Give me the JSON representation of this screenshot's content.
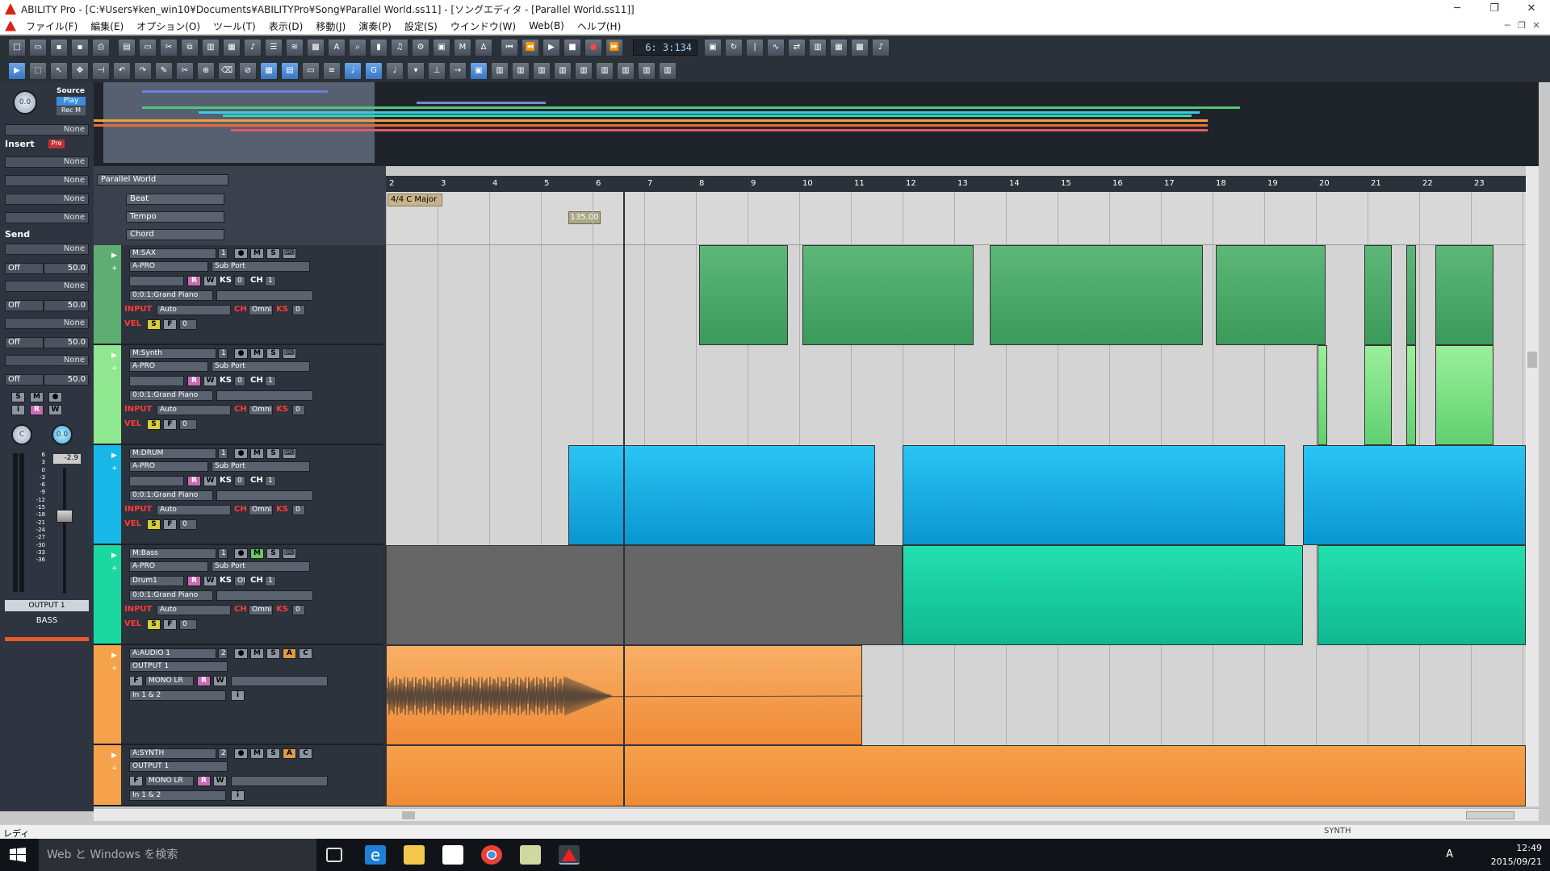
{
  "window": {
    "title": "ABILITY Pro - [C:¥Users¥ken_win10¥Documents¥ABILITYPro¥Song¥Parallel World.ss11] - [ソングエディタ - [Parallel World.ss11]]",
    "minimize": "─",
    "restore": "❐",
    "close": "✕"
  },
  "menu": [
    "ファイル(F)",
    "編集(E)",
    "オプション(O)",
    "ツール(T)",
    "表示(D)",
    "移動(J)",
    "演奏(P)",
    "設定(S)",
    "ウインドウ(W)",
    "Web(B)",
    "ヘルプ(H)"
  ],
  "transport": {
    "counter": "6: 3:134"
  },
  "left_panel": {
    "knob_value": "0.0",
    "source": "Source",
    "play": "Play",
    "recm": "Rec M",
    "none": "None",
    "insert": "Insert",
    "pre": "Pre",
    "send": "Send",
    "off": "Off",
    "send_value": "50.0",
    "smr": [
      "S",
      "M",
      "●"
    ],
    "irw": [
      "i",
      "R",
      "W"
    ],
    "knob2": "C",
    "knob3": "0.0",
    "fader_value": "-2.9",
    "meter_scale": [
      "6",
      "3",
      "0",
      "-3",
      "-6",
      "-9",
      "-12",
      "-15",
      "-18",
      "-21",
      "-24",
      "-27",
      "-30",
      "-33",
      "-36"
    ],
    "output": "OUTPUT 1",
    "track_name": "BASS"
  },
  "headers": {
    "song": "Parallel World",
    "beat": "Beat",
    "tempo": "Tempo",
    "chord": "Chord"
  },
  "markers": {
    "beat": "4/4 C Major",
    "tempo": "135.00"
  },
  "ruler": [
    "2",
    "3",
    "4",
    "5",
    "6",
    "7",
    "8",
    "9",
    "10",
    "11",
    "12",
    "13",
    "14",
    "15",
    "16",
    "17",
    "18",
    "19",
    "20",
    "21",
    "22",
    "23"
  ],
  "common": {
    "port": "A-PRO",
    "subport": "Sub Port",
    "patch": "0:0:1:Grand Piano",
    "input": "INPUT",
    "auto": "Auto",
    "ch": "CH",
    "omni": "Omni",
    "ks": "KS",
    "zero": "0",
    "one": "1",
    "vel": "VEL",
    "s": "S",
    "f": "F",
    "r": "R",
    "w": "W",
    "m": "M",
    "a": "A",
    "c": "C",
    "i": "i",
    "output": "OUTPUT 1",
    "mono": "MONO LR",
    "in": "In 1 & 2",
    "off": "OFF",
    "drum": "Drum1"
  },
  "tracks": [
    {
      "name": "M:SAX",
      "num": "1"
    },
    {
      "name": "M:Synth",
      "num": "1"
    },
    {
      "name": "M:DRUM",
      "num": "1"
    },
    {
      "name": "M:Bass",
      "num": "1"
    },
    {
      "name": "A:AUDIO 1",
      "num": "2"
    },
    {
      "name": "A:SYNTH",
      "num": "2"
    }
  ],
  "status": {
    "left": "レディ",
    "synth": "SYNTH"
  },
  "taskbar": {
    "search": "Web と Windows を検索",
    "time": "12:49",
    "date": "2015/09/21",
    "ime": "A"
  }
}
